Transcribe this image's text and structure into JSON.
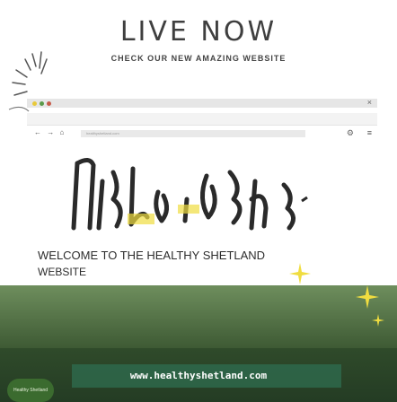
{
  "headline": "LIVE NOW",
  "subheadline": "CHECK OUR NEW AMAZING WEBSITE",
  "browser": {
    "url": "healthyshetland.com"
  },
  "welcome": {
    "line1": "WELCOME TO THE HEALTHY SHETLAND",
    "line2": "WEBSITE"
  },
  "footer_url": "www.healthyshetland.com",
  "badge_text": "Healthy Shetland",
  "icons": [
    "close-icon",
    "gear-icon",
    "menu-icon",
    "sparkle-icon",
    "burst-icon"
  ],
  "colors": {
    "accent_yellow": "#f0dd40",
    "text_dark": "#3f3f3f",
    "photo_green": "#2f4a2a"
  }
}
